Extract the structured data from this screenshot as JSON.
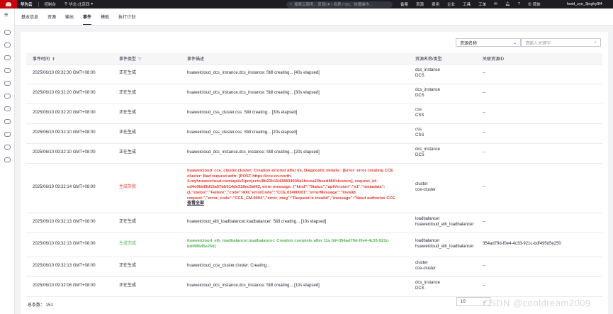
{
  "topbar": {
    "brand": "华为云",
    "console": "控制台",
    "region": "华北-北京四",
    "search_placeholder": "搜索云服务、资源(IP / 名称 / ID)、快捷操作...",
    "nav": [
      "备案",
      "资源",
      "费用",
      "企业",
      "工具",
      "工单"
    ],
    "lang": "简体",
    "user": "hwid_zyn_3jeghy9f4"
  },
  "tabs": [
    "基本信息",
    "资源",
    "输出",
    "事件",
    "模板",
    "执行计划"
  ],
  "active_tab_index": 3,
  "filter": {
    "select_value": "资源名称",
    "input_placeholder": "请输入关键字"
  },
  "table": {
    "headers": [
      "事件时间",
      "事件类型",
      "事件描述",
      "资源名称/类型",
      "关联资源ID"
    ],
    "rows": [
      {
        "time": "2025/06/10 09:32:30 GMT+08:00",
        "type": "正在生成",
        "status": "normal",
        "desc": "huaweicloud_dcs_instance.dcs_instance: Still creating... [40s elapsed]",
        "resource_name": "dcs_instance",
        "resource_type": "DCS",
        "resource_id": "--"
      },
      {
        "time": "2025/06/10 09:32:20 GMT+08:00",
        "type": "正在生成",
        "status": "normal",
        "desc": "huaweicloud_dcs_instance.dcs_instance: Still creating... [30s elapsed]",
        "resource_name": "dcs_instance",
        "resource_type": "DCS",
        "resource_id": "--"
      },
      {
        "time": "2025/06/10 09:32:20 GMT+08:00",
        "type": "正在生成",
        "status": "normal",
        "desc": "huaweicloud_css_cluster.css: Still creating... [30s elapsed]",
        "resource_name": "css",
        "resource_type": "CSS",
        "resource_id": "--"
      },
      {
        "time": "2025/06/10 09:32:10 GMT+08:00",
        "type": "正在生成",
        "status": "normal",
        "desc": "huaweicloud_css_cluster.css: Still creating... [20s elapsed]",
        "resource_name": "css",
        "resource_type": "CSS",
        "resource_id": "--"
      },
      {
        "time": "2025/06/10 09:32:10 GMT+08:00",
        "type": "正在生成",
        "status": "normal",
        "desc": "huaweicloud_dcs_instance.dcs_instance: Still creating... [20s elapsed]",
        "resource_name": "dcs_instance",
        "resource_type": "DCS",
        "resource_id": "--"
      },
      {
        "time": "2025/06/10 09:32:14 GMT+08:00",
        "type": "生成失败",
        "status": "error",
        "desc": "huaweicloud_cce_cluster.cluster: Creation errored after 0s, Diagnostic details : [Error: error creating CCE cluster: Bad request with: [POST https://cce.cn-north-4.myhuaweicloud.com/api/v3/projects/8b22b15d28834930a1fecea23bced86f/clusters], request_id: ed4e0bbf9d15a57bb914de318ec9af43, error message: {\"kind\":\"Status\",\"apiVersion\":\"v1\",\"metadata\":{},\"status\":\"Failure\",\"code\":400,\"errorCode\":\"CCE.01400001\",\"errorMessage\":\"Invalid request.\",\"error_code\":\"CCE_CM.0004\",\"error_msg\":\"Request is invalid\",\"message\":\"Need authorize CCE",
        "more": "查看全部",
        "resource_name": "cluster",
        "resource_type": "cce-cluster",
        "resource_id": "--"
      },
      {
        "time": "2025/06/10 09:32:13 GMT+08:00",
        "type": "正在生成",
        "status": "normal",
        "desc": "huaweicloud_elb_loadbalancer.loadbalancer: Still creating... [10s elapsed]",
        "resource_name": "loadbalancer",
        "resource_type": "huaweicloud_elb_loadbalancer",
        "resource_id": "--"
      },
      {
        "time": "2025/06/10 09:32:13 GMT+08:00",
        "type": "生成完成",
        "status": "ok",
        "desc": "huaweicloud_elb_loadbalancer.loadbalancer: Creation complete after 11s [id=354ad79d-f0e4-4c33-921c-bdf495d5e250]",
        "resource_name": "loadbalancer",
        "resource_type": "huaweicloud_elb_loadbalancer",
        "resource_id": "354ad79d-f0e4-4c33-921c-bdf495d5e250"
      },
      {
        "time": "2025/06/10 09:32:13 GMT+08:00",
        "type": "正在生成",
        "status": "normal",
        "desc": "huaweicloud_cce_cluster.cluster: Creating...",
        "resource_name": "cluster",
        "resource_type": "cce-cluster",
        "resource_id": "--"
      },
      {
        "time": "2025/06/10 09:32:06 GMT+08:00",
        "type": "正在生成",
        "status": "normal",
        "desc": "huaweicloud_dcs_instance.dcs_instance: Still creating... [10s elapsed]",
        "resource_name": "dcs_instance",
        "resource_type": "DCS",
        "resource_id": "--"
      }
    ]
  },
  "footer": {
    "total": "总条数： 151",
    "page_size": "10"
  },
  "watermark": "CSDN @cooldream2009"
}
